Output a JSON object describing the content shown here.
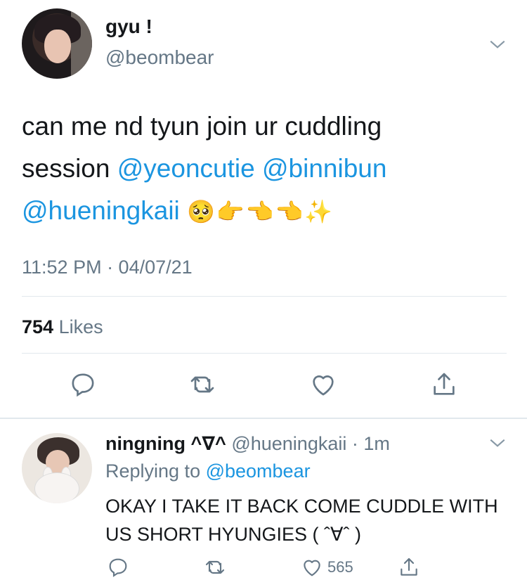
{
  "tweet": {
    "display_name": "gyu !",
    "handle": "@beombear",
    "text_plain_1": "can me nd tyun join ur cuddling",
    "text_plain_2": "session ",
    "mention_1": "@yeoncutie",
    "mention_2": "@binnibun",
    "mention_3": "@hueningkaii",
    "emojis": "🥺👉👈👈✨",
    "time": "11:52 PM · 04/07/21",
    "likes_count": "754",
    "likes_label": "Likes"
  },
  "reply": {
    "display_name": "ningning ^∇^",
    "meta": "@hueningkaii · 1m",
    "replying_label": "Replying to ",
    "replying_to": "@beombear",
    "text": "OKAY I TAKE IT BACK COME CUDDLE WITH US SHORT HYUNGIES ( ˆ∀ˆ )",
    "like_count": "565"
  },
  "colors": {
    "link": "#1b95e0",
    "secondary": "#657786",
    "divider": "#e1e8ed"
  }
}
